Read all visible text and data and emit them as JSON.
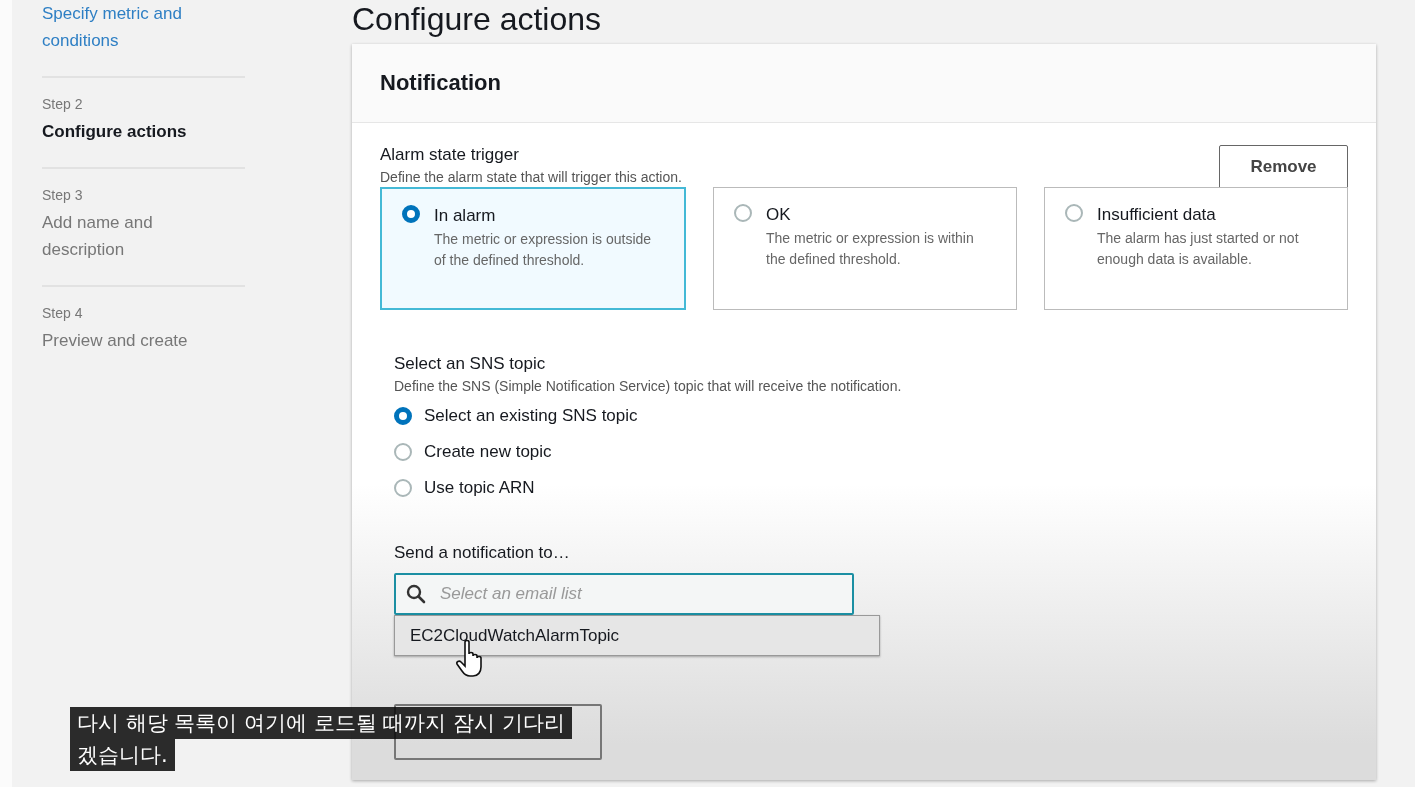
{
  "sidebar": {
    "steps": [
      {
        "title": "Specify metric and conditions",
        "kind": "link"
      },
      {
        "label": "Step 2",
        "title": "Configure actions",
        "kind": "current"
      },
      {
        "label": "Step 3",
        "title": "Add name and description",
        "kind": "upcoming"
      },
      {
        "label": "Step 4",
        "title": "Preview and create",
        "kind": "upcoming"
      }
    ]
  },
  "page_title": "Configure actions",
  "notification": {
    "title": "Notification",
    "remove_button": "Remove",
    "trigger": {
      "label": "Alarm state trigger",
      "description": "Define the alarm state that will trigger this action.",
      "options": [
        {
          "title": "In alarm",
          "description": "The metric or expression is outside of the defined threshold.",
          "selected": true
        },
        {
          "title": "OK",
          "description": "The metric or expression is within the defined threshold.",
          "selected": false
        },
        {
          "title": "Insufficient data",
          "description": "The alarm has just started or not enough data is available.",
          "selected": false
        }
      ]
    },
    "sns": {
      "label": "Select an SNS topic",
      "description": "Define the SNS (Simple Notification Service) topic that will receive the notification.",
      "options": [
        {
          "label": "Select an existing SNS topic",
          "selected": true
        },
        {
          "label": "Create new topic",
          "selected": false
        },
        {
          "label": "Use topic ARN",
          "selected": false
        }
      ]
    },
    "send_to": {
      "label": "Send a notification to…",
      "placeholder": "Select an email list",
      "suggestions": [
        "EC2CloudWatchAlarmTopic"
      ]
    }
  },
  "subtitle": {
    "lines": [
      "다시 해당 목록이 여기에 로드될 때까지 잠시 기다리",
      "겠습니다."
    ]
  }
}
